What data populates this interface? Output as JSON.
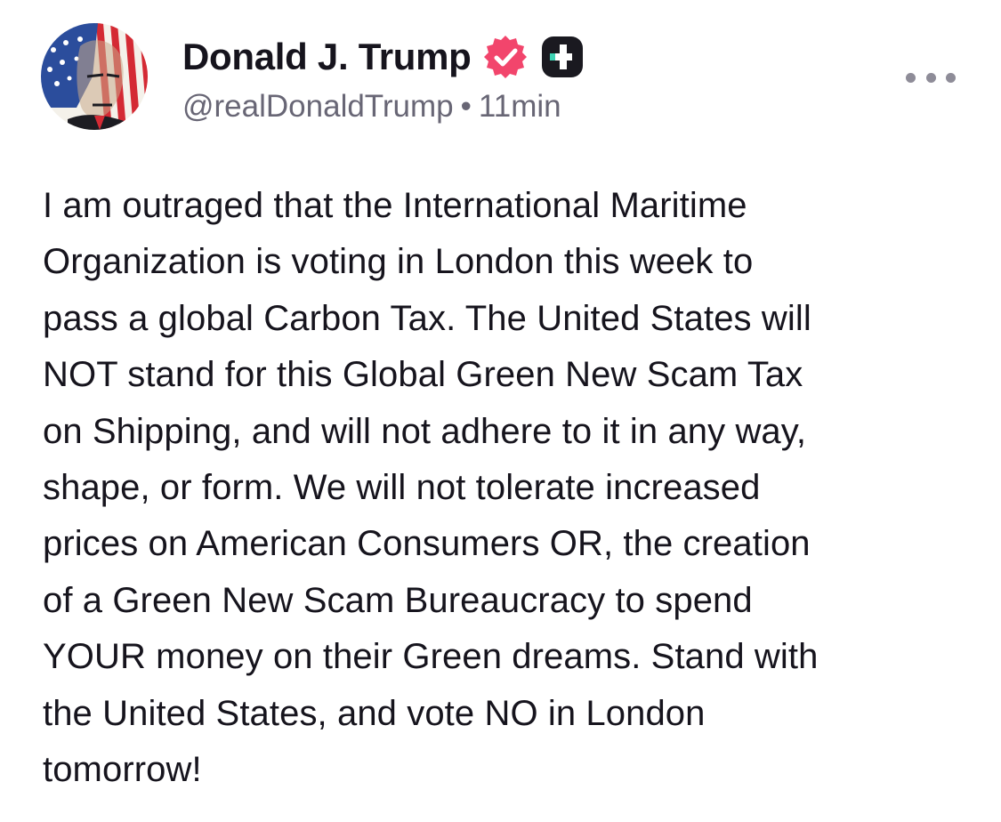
{
  "author": {
    "display_name": "Donald J. Trump",
    "handle": "@realDonaldTrump",
    "separator": "•",
    "time_ago": "11min",
    "avatar_icon": "stars-and-stripes-portrait-avatar",
    "verified_icon": "verified-badge-icon",
    "verified_color": "#f2456c",
    "plus_badge_icon": "plus-badge-icon"
  },
  "menu": {
    "more_icon": "more-dots-icon"
  },
  "post": {
    "lines": [
      "I am outraged that the International Maritime",
      "Organization is voting in London this week to",
      "pass a global Carbon Tax. The United States will",
      "NOT stand for this Global Green New Scam Tax",
      "on Shipping, and will not adhere to it in any way,",
      "shape, or form. We will not tolerate increased",
      "prices on American Consumers OR, the creation",
      "of a Green New Scam Bureaucracy to spend",
      "YOUR money on their Green dreams. Stand with",
      "the United States, and vote NO in London",
      "tomorrow!"
    ]
  }
}
